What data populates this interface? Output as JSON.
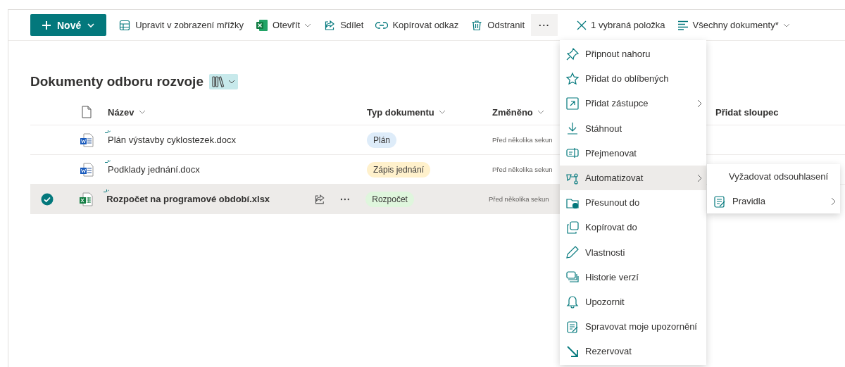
{
  "toolbar": {
    "new_button": "Nové",
    "actions": [
      {
        "label": "Upravit v zobrazení mřížky",
        "has_dropdown": false
      },
      {
        "label": "Otevřít",
        "has_dropdown": true
      },
      {
        "label": "Sdílet",
        "has_dropdown": false
      },
      {
        "label": "Kopírovat odkaz",
        "has_dropdown": false
      },
      {
        "label": "Odstranit",
        "has_dropdown": false
      }
    ],
    "more_button": {
      "label": "···",
      "selected": true
    },
    "selection": "1 vybraná položka",
    "view": "Všechny dokumenty*"
  },
  "library": {
    "title": "Dokumenty odboru rozvoje"
  },
  "table": {
    "columns": [
      "Název",
      "Typ dokumentu",
      "Změněno",
      "Přidat sloupec"
    ],
    "rows": [
      {
        "name": "Plán výstavby cyklostezek.docx",
        "kind": "docx",
        "is_new": true,
        "selected": false,
        "type": {
          "label": "Plán",
          "color": "#deecf9"
        },
        "modified": "Před několika sekun"
      },
      {
        "name": "Podklady jednání.docx",
        "kind": "docx",
        "is_new": true,
        "selected": false,
        "type": {
          "label": "Zápis jednání",
          "color": "#fff1cc"
        },
        "modified": "Před několika sekun"
      },
      {
        "name": "Rozpočet na programové období.xlsx",
        "kind": "xlsx",
        "is_new": true,
        "selected": true,
        "type": {
          "label": "Rozpočet",
          "color": "#dff6dd"
        },
        "modified": "Před několika sekun"
      }
    ]
  },
  "context_menu": [
    {
      "label": "Připnout nahoru",
      "submenu": false,
      "selected": false
    },
    {
      "label": "Přidat do oblíbených",
      "submenu": false,
      "selected": false
    },
    {
      "label": "Přidat zástupce",
      "submenu": true,
      "selected": false
    },
    {
      "label": "Stáhnout",
      "submenu": false,
      "selected": false
    },
    {
      "label": "Přejmenovat",
      "submenu": false,
      "selected": false
    },
    {
      "label": "Automatizovat",
      "submenu": true,
      "selected": true
    },
    {
      "label": "Přesunout do",
      "submenu": false,
      "selected": false
    },
    {
      "label": "Kopírovat do",
      "submenu": false,
      "selected": false
    },
    {
      "label": "Vlastnosti",
      "submenu": false,
      "selected": false
    },
    {
      "label": "Historie verzí",
      "submenu": false,
      "selected": false
    },
    {
      "label": "Upozornit",
      "submenu": false,
      "selected": false
    },
    {
      "label": "Spravovat moje upozornění",
      "submenu": false,
      "selected": false
    },
    {
      "label": "Rezervovat",
      "submenu": false,
      "selected": false
    }
  ],
  "submenu": [
    {
      "label": "Vyžadovat odsouhlasení",
      "icon": false,
      "submenu": false
    },
    {
      "label": "Pravidla",
      "icon": true,
      "submenu": true
    }
  ]
}
